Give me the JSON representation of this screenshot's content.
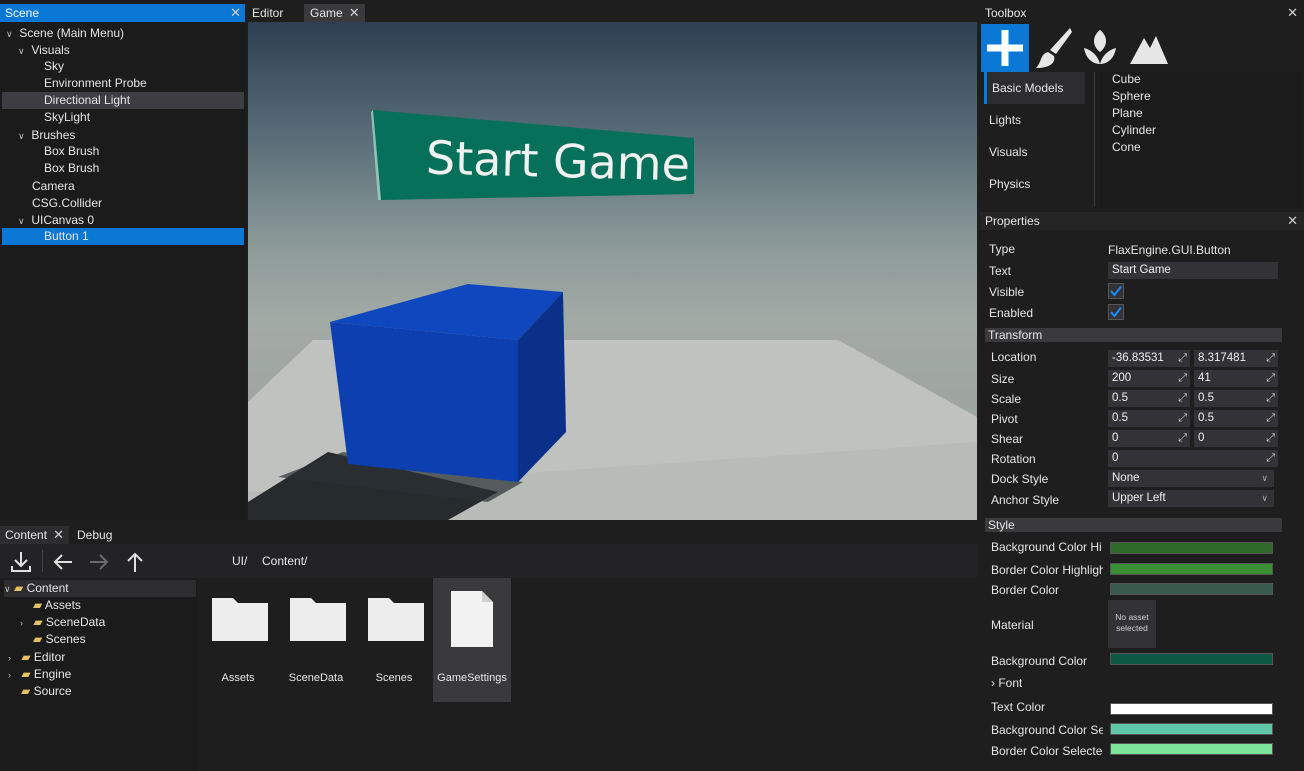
{
  "scene_panel": {
    "title": "Scene",
    "items": [
      {
        "label": "Scene (Main Menu)"
      },
      {
        "label": "Visuals"
      },
      {
        "label": "Sky"
      },
      {
        "label": "Environment Probe"
      },
      {
        "label": "Directional Light"
      },
      {
        "label": "SkyLight"
      },
      {
        "label": "Brushes"
      },
      {
        "label": "Box Brush"
      },
      {
        "label": "Box Brush"
      },
      {
        "label": "Camera"
      },
      {
        "label": "CSG.Collider"
      },
      {
        "label": "UICanvas 0"
      },
      {
        "label": "Button 1"
      }
    ]
  },
  "editor_tabs": {
    "editor": "Editor",
    "game": "Game"
  },
  "viewport": {
    "button_text": "Start Game",
    "button_color": "#06705a",
    "cube_color": "#0d3fb0"
  },
  "content_panel": {
    "tabs": {
      "content": "Content",
      "debug": "Debug"
    },
    "breadcrumb": [
      "UI/",
      "Content/"
    ],
    "tree": [
      {
        "label": "Content"
      },
      {
        "label": "Assets"
      },
      {
        "label": "SceneData"
      },
      {
        "label": "Scenes"
      },
      {
        "label": "Editor"
      },
      {
        "label": "Engine"
      },
      {
        "label": "Source"
      }
    ],
    "tiles": [
      {
        "label": "Assets",
        "icon": "folder-icon"
      },
      {
        "label": "SceneData",
        "icon": "folder-icon"
      },
      {
        "label": "Scenes",
        "icon": "folder-icon"
      },
      {
        "label": "GameSettings",
        "icon": "file-icon"
      }
    ]
  },
  "toolbox": {
    "title": "Toolbox",
    "categories": [
      "Basic Models",
      "Lights",
      "Visuals",
      "Physics"
    ],
    "items": [
      "Cube",
      "Sphere",
      "Plane",
      "Cylinder",
      "Cone"
    ]
  },
  "properties": {
    "title": "Properties",
    "type_label": "Type",
    "type_value": "FlaxEngine.GUI.Button",
    "text_label": "Text",
    "text_value": "Start Game",
    "visible_label": "Visible",
    "enabled_label": "Enabled",
    "visible": true,
    "enabled": true,
    "transform_head": "Transform",
    "location_label": "Location",
    "location": [
      "-36.83531",
      "8.317481"
    ],
    "size_label": "Size",
    "size": [
      "200",
      "41"
    ],
    "scale_label": "Scale",
    "scale": [
      "0.5",
      "0.5"
    ],
    "pivot_label": "Pivot",
    "pivot": [
      "0.5",
      "0.5"
    ],
    "shear_label": "Shear",
    "shear": [
      "0",
      "0"
    ],
    "rotation_label": "Rotation",
    "rotation": "0",
    "dock_label": "Dock Style",
    "dock_value": "None",
    "anchor_label": "Anchor Style",
    "anchor_value": "Upper Left",
    "style_head": "Style",
    "bg_hi_label": "Background Color Hi",
    "border_hi_label": "Border Color Highligh",
    "border_label": "Border Color",
    "material_label": "Material",
    "material_value_1": "No asset",
    "material_value_2": "selected",
    "bg_label": "Background Color",
    "font_label": "Font",
    "text_color_label": "Text Color",
    "bg_sel_label": "Background Color Se",
    "border_sel_label": "Border Color Selected",
    "colors": {
      "bg_hi": "#2f6a2b",
      "border_hi": "#3a8e34",
      "border": "#3b5a4e",
      "bg": "#0c5845",
      "text": "#ffffff",
      "bg_sel": "#5fc7a8",
      "border_sel": "#7be39a"
    }
  }
}
